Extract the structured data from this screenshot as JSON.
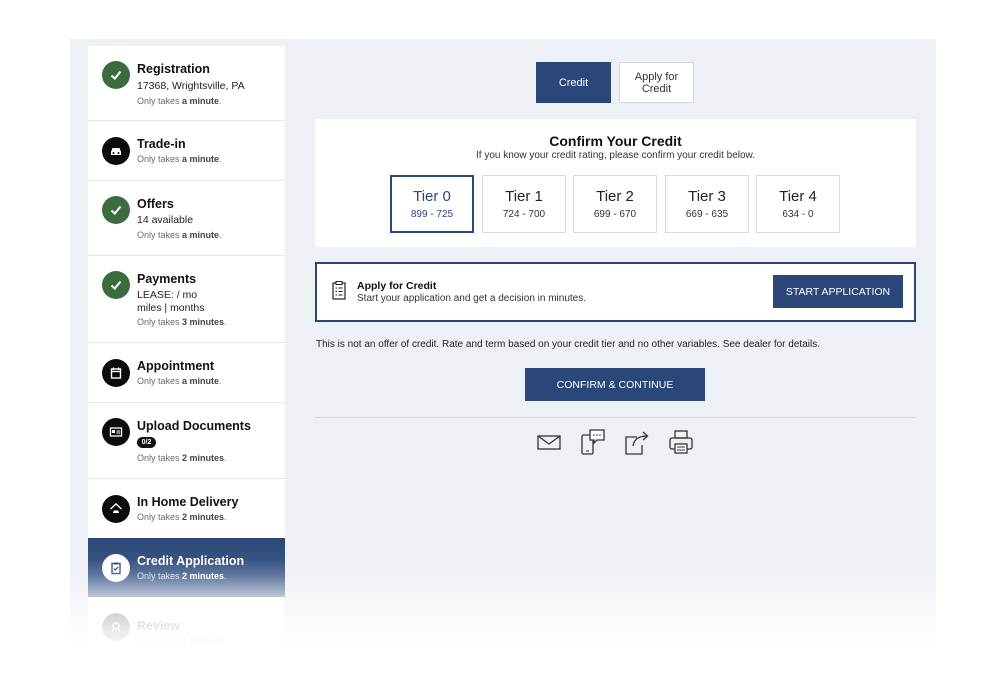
{
  "sidebar": {
    "steps": [
      {
        "title": "Registration",
        "line1": "17368, Wrightsville, PA",
        "sub_prefix": "Only takes ",
        "sub_bold": "a minute",
        "sub_suffix": "."
      },
      {
        "title": "Trade-in",
        "sub_prefix": "Only takes ",
        "sub_bold": "a minute",
        "sub_suffix": "."
      },
      {
        "title": "Offers",
        "line1": "14 available",
        "sub_prefix": "Only takes ",
        "sub_bold": "a minute",
        "sub_suffix": "."
      },
      {
        "title": "Payments",
        "line1": "LEASE: / mo",
        "line2": "miles | months",
        "sub_prefix": "Only takes ",
        "sub_bold": "3 minutes",
        "sub_suffix": "."
      },
      {
        "title": "Appointment",
        "sub_prefix": "Only takes ",
        "sub_bold": "a minute",
        "sub_suffix": "."
      },
      {
        "title": "Upload Documents",
        "badge": "0/2",
        "sub_prefix": "Only takes ",
        "sub_bold": "2 minutes",
        "sub_suffix": "."
      },
      {
        "title": "In Home Delivery",
        "sub_prefix": "Only takes ",
        "sub_bold": "2 minutes",
        "sub_suffix": "."
      },
      {
        "title": "Credit Application",
        "sub_prefix": "Only takes ",
        "sub_bold": "2 minutes",
        "sub_suffix": "."
      },
      {
        "title": "Review",
        "sub_prefix": "Only takes ",
        "sub_bold": "2 minutes",
        "sub_suffix": "."
      }
    ]
  },
  "tabs": {
    "credit": "Credit",
    "apply_line1": "Apply for",
    "apply_line2": "Credit"
  },
  "confirm": {
    "heading": "Confirm Your Credit",
    "subheading": "If you know your credit rating, please confirm your credit below.",
    "tiers": [
      {
        "name": "Tier 0",
        "range": "899 - 725"
      },
      {
        "name": "Tier 1",
        "range": "724 - 700"
      },
      {
        "name": "Tier 2",
        "range": "699 - 670"
      },
      {
        "name": "Tier 3",
        "range": "669 - 635"
      },
      {
        "name": "Tier 4",
        "range": "634 - 0"
      }
    ]
  },
  "apply": {
    "title": "Apply for Credit",
    "description": "Start your application and get a decision in minutes.",
    "button": "START APPLICATION"
  },
  "disclaimer": "This is not an offer of credit. Rate and term based on your credit tier and no other variables. See dealer for details.",
  "confirm_button": "CONFIRM & CONTINUE",
  "colors": {
    "accent": "#2b477a",
    "complete": "#3c6b3f",
    "background": "#edf0f5"
  },
  "share_icons": [
    "email-icon",
    "text-message-icon",
    "share-icon",
    "print-icon"
  ]
}
